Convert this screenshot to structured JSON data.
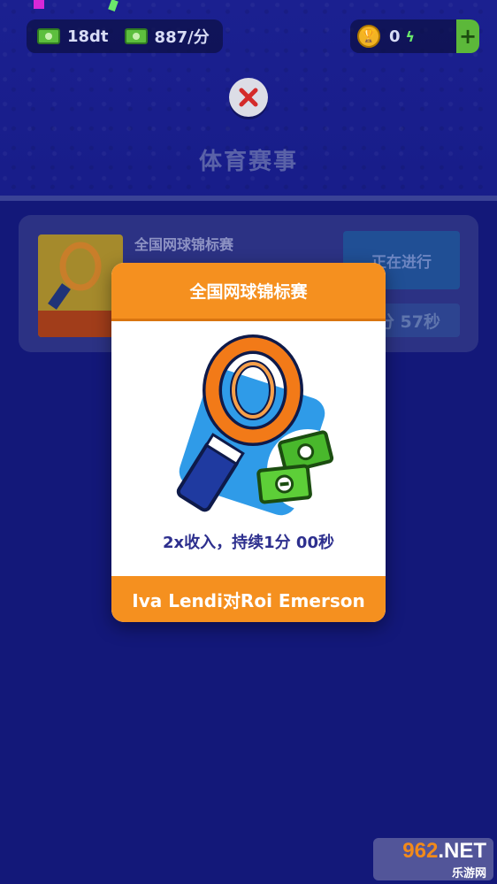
{
  "hud": {
    "cash_value": "18dt",
    "income_rate": "887/分",
    "coins_value": "0",
    "plus_label": "+"
  },
  "page": {
    "title": "体育赛事"
  },
  "event_card": {
    "name": "全国网球锦标赛",
    "status": "正在进行",
    "timer": "分 57秒"
  },
  "modal": {
    "title": "全国网球锦标赛",
    "description": "2x收入，持续1分 00秒",
    "matchup": "Iva Lendi对Roi Emerson"
  },
  "watermark": {
    "brand": "962",
    "suffix": ".NET",
    "sub": "乐游网"
  },
  "colors": {
    "background": "#151a84",
    "accent_orange": "#f5901f",
    "cash_green": "#5dbf3e",
    "modal_text": "#2d2f8e"
  }
}
